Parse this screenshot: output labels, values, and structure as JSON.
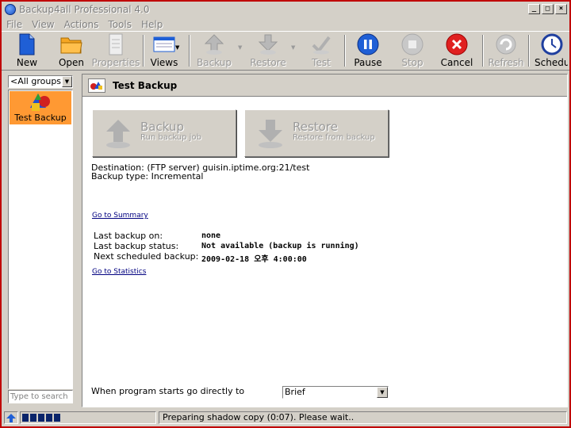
{
  "window": {
    "title": "Backup4all Professional 4.0",
    "controls": {
      "minimize": "_",
      "maximize": "□",
      "close": "×"
    }
  },
  "menu": {
    "items": [
      {
        "label": "File"
      },
      {
        "label": "View"
      },
      {
        "label": "Actions"
      },
      {
        "label": "Tools"
      },
      {
        "label": "Help"
      }
    ]
  },
  "toolbar": {
    "new": "New",
    "open": "Open",
    "properties": "Properties",
    "views": "Views",
    "backup": "Backup",
    "restore": "Restore",
    "test": "Test",
    "pause": "Pause",
    "stop": "Stop",
    "cancel": "Cancel",
    "refresh": "Refresh",
    "scheduler": "Schedu"
  },
  "sidebar": {
    "group_filter": "<All groups>",
    "jobs": [
      {
        "label": "Test Backup"
      }
    ],
    "search_placeholder": "Type to search"
  },
  "main": {
    "title": "Test Backup",
    "backup_button": {
      "title": "Backup",
      "subtitle": "Run backup job"
    },
    "restore_button": {
      "title": "Restore",
      "subtitle": "Restore from backup"
    },
    "destination": "Destination: (FTP server) guisin.iptime.org:21/test",
    "backup_type": "Backup type: Incremental",
    "summary_link": "Go to Summary",
    "stats": {
      "last_backup_label": "Last backup on:",
      "last_backup_value": "none",
      "status_label": "Last backup status:",
      "status_value": "Not available (backup is running)",
      "next_label": "Next scheduled backup:",
      "next_value": "2009-02-18 오후 4:00:00"
    },
    "statistics_link": "Go to Statistics",
    "startup_label": "When program starts go directly to",
    "startup_value": "Brief"
  },
  "statusbar": {
    "progress_blocks": 5,
    "message": "Preparing shadow copy (0:07). Please wait.."
  }
}
